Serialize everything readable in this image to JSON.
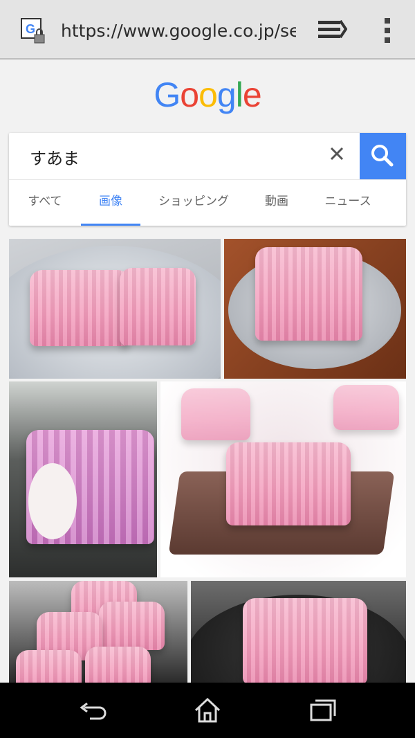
{
  "browser": {
    "url": "https://www.google.co.jp/search",
    "tab_icon": "google-secure-icon",
    "tabs_icon": "tabs-icon",
    "menu_icon": "overflow-menu-icon"
  },
  "logo": {
    "letters": [
      "G",
      "o",
      "o",
      "g",
      "l",
      "e"
    ],
    "colors": [
      "#4285f4",
      "#ea4335",
      "#fbbc05",
      "#4285f4",
      "#34a853",
      "#ea4335"
    ]
  },
  "search": {
    "query": "すあま",
    "clear_icon": "close-icon",
    "search_icon": "search-icon"
  },
  "tabs": [
    {
      "label": "すべて",
      "active": false
    },
    {
      "label": "画像",
      "active": true
    },
    {
      "label": "ショッピング",
      "active": false
    },
    {
      "label": "動画",
      "active": false
    },
    {
      "label": "ニュース",
      "active": false
    }
  ],
  "colors": {
    "accent": "#4285f4",
    "toolbar": "#e4e4e4",
    "navbar": "#000000"
  },
  "navbar": {
    "back_icon": "back-icon",
    "home_icon": "home-icon",
    "recents_icon": "recents-icon"
  }
}
